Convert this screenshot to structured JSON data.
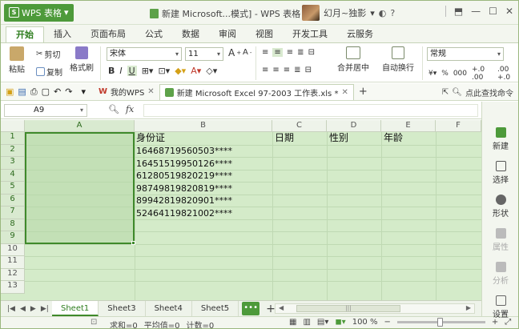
{
  "titlebar": {
    "app_name": "WPS 表格",
    "document_title": "新建 Microsoft...模式] - WPS 表格",
    "user_name": "幻月~独影",
    "help_label": "?"
  },
  "ribbon_tabs": [
    "开始",
    "插入",
    "页面布局",
    "公式",
    "数据",
    "审阅",
    "视图",
    "开发工具",
    "云服务"
  ],
  "ribbon": {
    "paste": "粘贴",
    "cut": "剪切",
    "copy": "复制",
    "format_painter": "格式刷",
    "font_name": "宋体",
    "font_size": "11",
    "bold": "B",
    "italic": "I",
    "underline": "U",
    "merge_center": "合并居中",
    "wrap_text": "自动换行",
    "number_format": "常规",
    "percent": "%",
    "comma": "000",
    "inc_decimal": "+.0 .00",
    "dec_decimal": ".00 +.0"
  },
  "doc_tabs": {
    "home_tab": "我的WPS",
    "file_tab": "新建 Microsoft Excel 97-2003 工作表.xls *",
    "search_cmd": "点此查找命令"
  },
  "formula_bar": {
    "cell_ref": "A9",
    "fx_label": "fx",
    "content": ""
  },
  "columns": [
    "A",
    "B",
    "C",
    "D",
    "E",
    "F"
  ],
  "rows": [
    "1",
    "2",
    "3",
    "4",
    "5",
    "6",
    "7",
    "8",
    "9",
    "10",
    "11",
    "12",
    "13"
  ],
  "cells": {
    "b1": "身份证",
    "c1": "日期",
    "d1": "性别",
    "e1": "年龄",
    "b2": "16468719560503****",
    "b3": "16451519950126****",
    "b4": "61280519820219****",
    "b5": "98749819820819****",
    "b6": "89942819820901****",
    "b7": "52464119821002****"
  },
  "sheets": [
    "Sheet1",
    "Sheet3",
    "Sheet4",
    "Sheet5"
  ],
  "sheet_more": "•••",
  "sheet_add": "+",
  "status": {
    "sum": "求和=0",
    "average": "平均值=0",
    "count": "计数=0",
    "zoom": "100 %"
  },
  "side_panel": [
    "新建",
    "选择",
    "形状",
    "属性",
    "分析",
    "设置"
  ],
  "colors": {
    "accent": "#4d9a3a",
    "selection_fill": "#d4ebc9",
    "selection_border": "#3f8a2b"
  }
}
